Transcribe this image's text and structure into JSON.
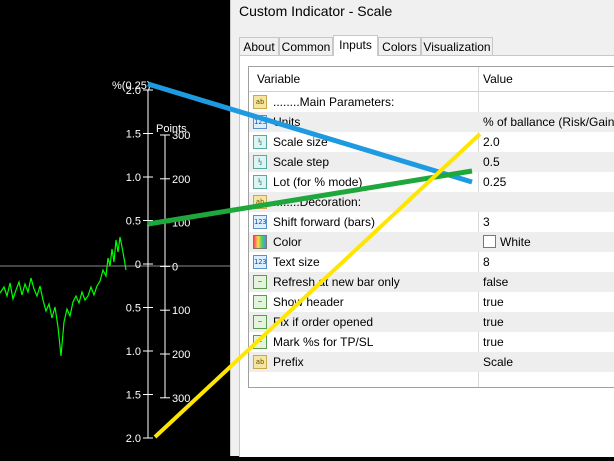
{
  "window": {
    "title": "Custom Indicator - Scale"
  },
  "tabs": [
    {
      "label": "About"
    },
    {
      "label": "Common"
    },
    {
      "label": "Inputs"
    },
    {
      "label": "Colors"
    },
    {
      "label": "Visualization"
    }
  ],
  "table": {
    "headers": [
      "Variable",
      "Value"
    ],
    "rows": [
      {
        "icon": "ab",
        "variable": "........Main Parameters:",
        "value": ""
      },
      {
        "icon": "123",
        "variable": "Units",
        "value": "% of ballance (Risk/Gain)"
      },
      {
        "icon": "1/2",
        "variable": "Scale size",
        "value": "2.0"
      },
      {
        "icon": "1/2",
        "variable": "Scale step",
        "value": "0.5"
      },
      {
        "icon": "1/2",
        "variable": "Lot (for % mode)",
        "value": "0.25"
      },
      {
        "icon": "ab",
        "variable": "........Decoration:",
        "value": ""
      },
      {
        "icon": "123",
        "variable": "Shift forward (bars)",
        "value": "3"
      },
      {
        "icon": "color",
        "variable": "Color",
        "value": "White"
      },
      {
        "icon": "123",
        "variable": "Text size",
        "value": "8"
      },
      {
        "icon": "bool",
        "variable": "Refresh at new bar only",
        "value": "false"
      },
      {
        "icon": "bool",
        "variable": "Show header",
        "value": "true"
      },
      {
        "icon": "bool",
        "variable": "Fix if order opened",
        "value": "true"
      },
      {
        "icon": "bool",
        "variable": "Mark %s for TP/SL",
        "value": "true"
      },
      {
        "icon": "ab",
        "variable": "Prefix",
        "value": "Scale"
      }
    ]
  },
  "chart": {
    "top_label": "%(0.25)",
    "points_label": "Points",
    "left_scale": [
      "2.0",
      "1.5",
      "1.0",
      "0.5",
      "0",
      "0.5",
      "1.0",
      "1.5",
      "2.0"
    ],
    "right_scale": [
      "300",
      "200",
      "100",
      "0",
      "100",
      "200",
      "300"
    ],
    "price_color": "#00ff00",
    "axis_color": "#ffffff"
  },
  "annotations": {
    "colors": {
      "blue": "#1e9be0",
      "green": "#1ea83c",
      "yellow": "#ffe600"
    }
  }
}
